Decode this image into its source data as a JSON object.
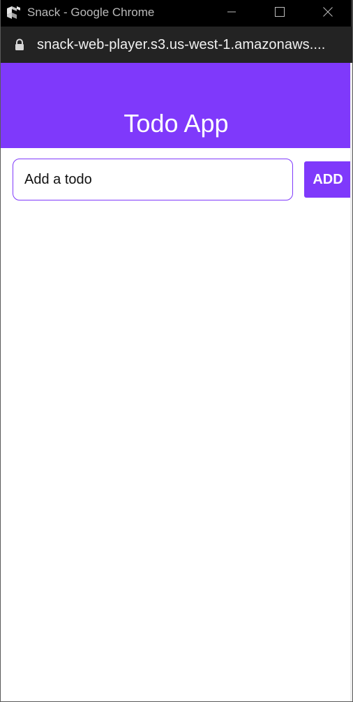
{
  "window": {
    "title": "Snack - Google Chrome",
    "app_icon": "snack-logo-icon",
    "controls": {
      "minimize_icon": "minimize-icon",
      "maximize_icon": "maximize-icon",
      "close_icon": "close-icon"
    }
  },
  "addressbar": {
    "lock_icon": "lock-icon",
    "url": "snack-web-player.s3.us-west-1.amazonaws...."
  },
  "app": {
    "header": {
      "title": "Todo App"
    },
    "input": {
      "value": "",
      "placeholder": "Add a todo"
    },
    "add_button": {
      "label": "ADD"
    },
    "todos": []
  },
  "colors": {
    "accent": "#7f39fb",
    "titlebar": "#000000",
    "addressbar": "#232323",
    "header_text": "#ffffff"
  }
}
